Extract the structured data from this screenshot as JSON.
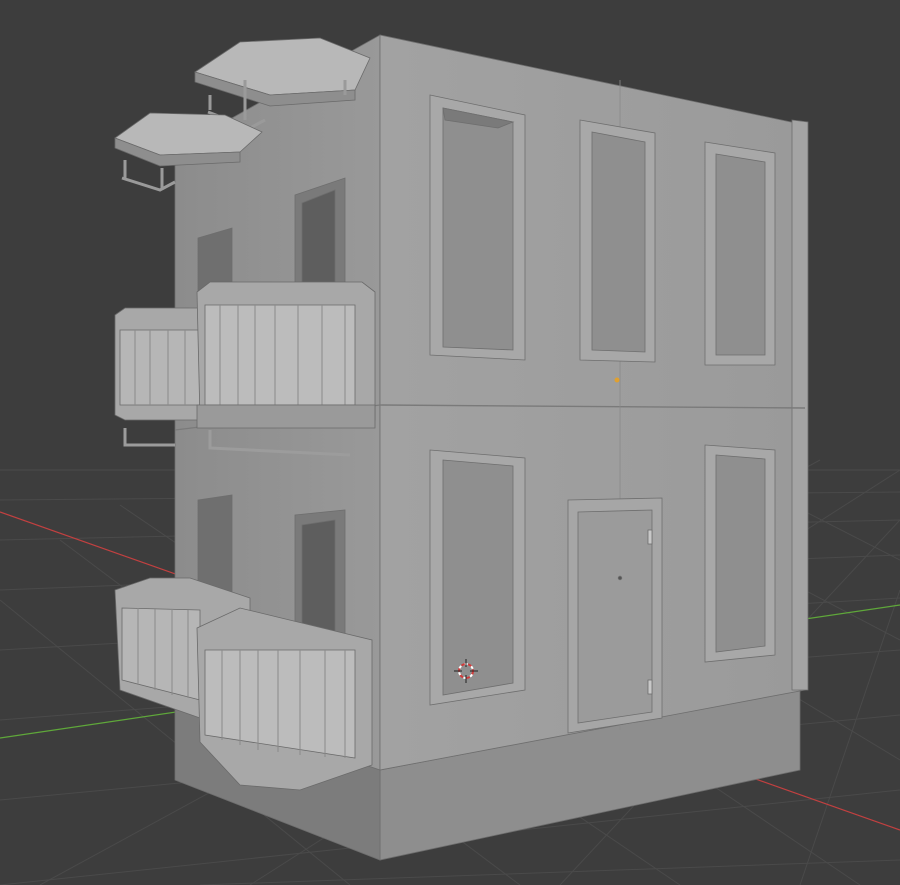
{
  "viewport": {
    "background": "#3d3d3d",
    "grid_color": "#4a4a4a",
    "x_axis_color": "#c24040",
    "y_axis_color": "#5fa83a",
    "model_color": "#9c9c9c",
    "origin_marker_color": "#e0a030"
  },
  "scene": {
    "objects": [
      {
        "name": "building",
        "type": "mesh"
      },
      {
        "name": "3d-cursor",
        "type": "cursor"
      },
      {
        "name": "object-origin",
        "type": "origin"
      }
    ]
  }
}
